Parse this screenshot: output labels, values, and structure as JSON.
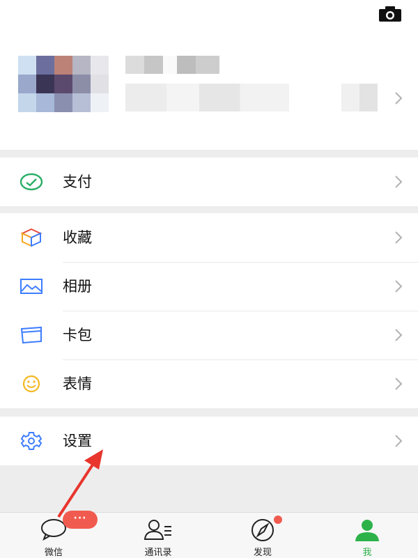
{
  "header": {
    "camera_icon": "camera-icon"
  },
  "menu": {
    "payment": {
      "label": "支付",
      "icon": "wallet-icon"
    },
    "favorites": {
      "label": "收藏",
      "icon": "cube-icon"
    },
    "album": {
      "label": "相册",
      "icon": "picture-icon"
    },
    "cards": {
      "label": "卡包",
      "icon": "card-icon"
    },
    "stickers": {
      "label": "表情",
      "icon": "smiley-icon"
    },
    "settings": {
      "label": "设置",
      "icon": "gear-icon"
    }
  },
  "tabbar": {
    "tabs": [
      {
        "label": "微信",
        "icon": "chat-bubble-icon",
        "badge": "···"
      },
      {
        "label": "通讯录",
        "icon": "contacts-icon"
      },
      {
        "label": "发现",
        "icon": "compass-icon"
      },
      {
        "label": "我",
        "icon": "person-icon"
      }
    ],
    "active_color": "#2db24a"
  },
  "colors": {
    "badge": "#f15b4f",
    "annotation_arrow": "#e8352d"
  }
}
